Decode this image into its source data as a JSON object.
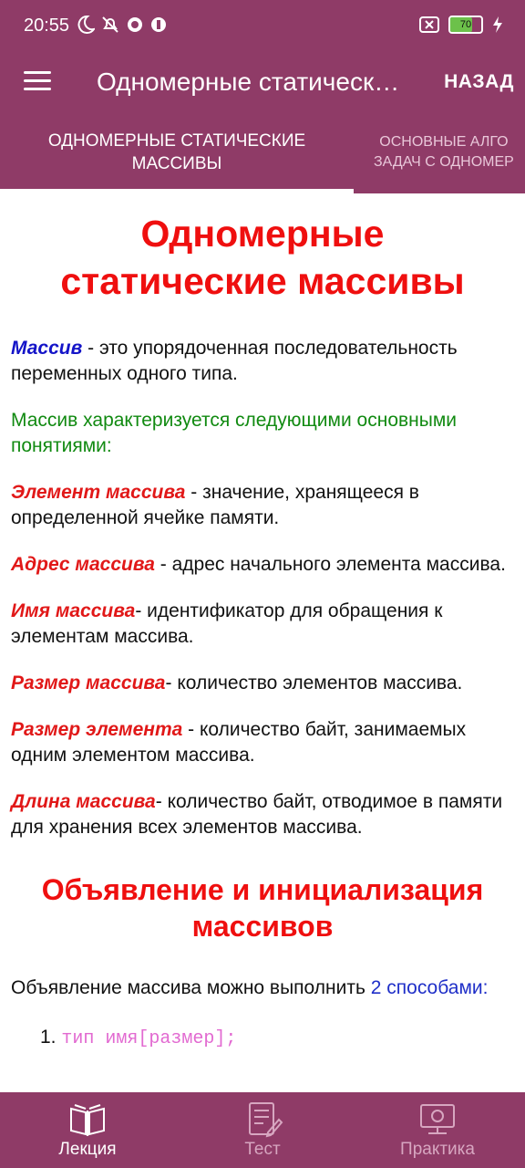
{
  "status": {
    "time": "20:55",
    "battery": "70"
  },
  "appbar": {
    "title": "Одномерные статическ…",
    "back": "НАЗАД"
  },
  "tabs": [
    {
      "label_line1": "ОДНОМЕРНЫЕ СТАТИЧЕСКИЕ",
      "label_line2": "МАССИВЫ"
    },
    {
      "label_line1": "ОСНОВНЫЕ АЛГО",
      "label_line2": "ЗАДАЧ С ОДНОМЕР"
    }
  ],
  "content": {
    "title_line1": "Одномерные",
    "title_line2": "статические массивы",
    "def_term": "Массив",
    "def_text": " - это упорядоченная последовательность переменных одного типа.",
    "green_line": "Массив характеризуется следующими основными понятиями:",
    "items": [
      {
        "term": "Элемент массива",
        "text": " - значение, хранящееся в определенной ячейке памяти."
      },
      {
        "term": "Адрес массива",
        "text": " - адрес начального элемента массива."
      },
      {
        "term": "Имя массива",
        "text": "- идентификатор для обращения к элементам массива."
      },
      {
        "term": "Размер массива",
        "text": "- количество элементов массива."
      },
      {
        "term": "Размер элемента",
        "text": " - количество байт, занимаемых одним элементом массива."
      },
      {
        "term": "Длина массива",
        "text": "- количество байт, отводимое в памяти для хранения всех элементов массива."
      }
    ],
    "section2_title": "Объявление и инициализация массивов",
    "decl_text": "Объявление массива можно выполнить ",
    "decl_highlight": "2 способами:",
    "list_item1_num": "1.",
    "list_item1_code": "тип имя[размер];"
  },
  "bottom_nav": [
    {
      "label": "Лекция",
      "icon": "book-icon"
    },
    {
      "label": "Тест",
      "icon": "test-form-icon"
    },
    {
      "label": "Практика",
      "icon": "computer-icon"
    }
  ]
}
